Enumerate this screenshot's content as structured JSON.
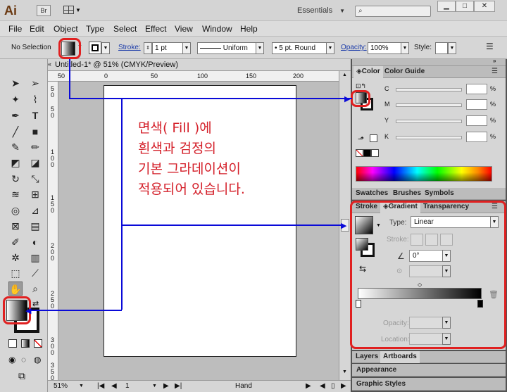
{
  "app": {
    "logo": "Ai",
    "bridge_label": "Br",
    "workspace": "Essentials"
  },
  "menubar": {
    "items": [
      "File",
      "Edit",
      "Object",
      "Type",
      "Select",
      "Effect",
      "View",
      "Window",
      "Help"
    ]
  },
  "controlbar": {
    "selection": "No Selection",
    "stroke_label": "Stroke:",
    "stroke_weight": "1 pt",
    "profile": "Uniform",
    "brush": "5 pt. Round",
    "opacity_label": "Opacity:",
    "opacity_value": "100%",
    "style_label": "Style:"
  },
  "document": {
    "tab_title": "Untitled-1* @ 51% (CMYK/Preview)",
    "ruler_h": [
      "50",
      "0",
      "50",
      "100",
      "150",
      "200",
      "250"
    ],
    "ruler_v": [
      "5",
      "0",
      "5",
      "0",
      "1",
      "0",
      "0",
      "1",
      "5",
      "0",
      "2",
      "0",
      "0",
      "2",
      "5",
      "0",
      "3",
      "0",
      "0",
      "3",
      "5",
      "0"
    ],
    "annotation": "면색( Fill )에\n흰색과 검정의\n기본 그라데이션이\n적용되어 있습니다."
  },
  "statusbar": {
    "zoom": "51%",
    "page": "1",
    "tool": "Hand"
  },
  "color_panel": {
    "tabs": [
      "Color",
      "Color Guide"
    ],
    "channels": [
      {
        "label": "C",
        "value": "",
        "unit": "%"
      },
      {
        "label": "M",
        "value": "",
        "unit": "%"
      },
      {
        "label": "Y",
        "value": "",
        "unit": "%"
      },
      {
        "label": "K",
        "value": "",
        "unit": "%"
      }
    ]
  },
  "swatch_tabs": [
    "Swatches",
    "Brushes",
    "Symbols"
  ],
  "gradient_panel": {
    "tabs": [
      "Stroke",
      "Gradient",
      "Transparency"
    ],
    "type_label": "Type:",
    "type_value": "Linear",
    "stroke_label": "Stroke:",
    "angle_value": "0°",
    "opacity_label": "Opacity:",
    "location_label": "Location:"
  },
  "bottom_panels": {
    "layers_tabs": [
      "Layers",
      "Artboards"
    ],
    "appearance": "Appearance",
    "graphic_styles": "Graphic Styles"
  },
  "colors": {
    "annotation_red": "#d4202a",
    "frame_red": "#e02020",
    "pointer_blue": "#0a0ad8"
  }
}
